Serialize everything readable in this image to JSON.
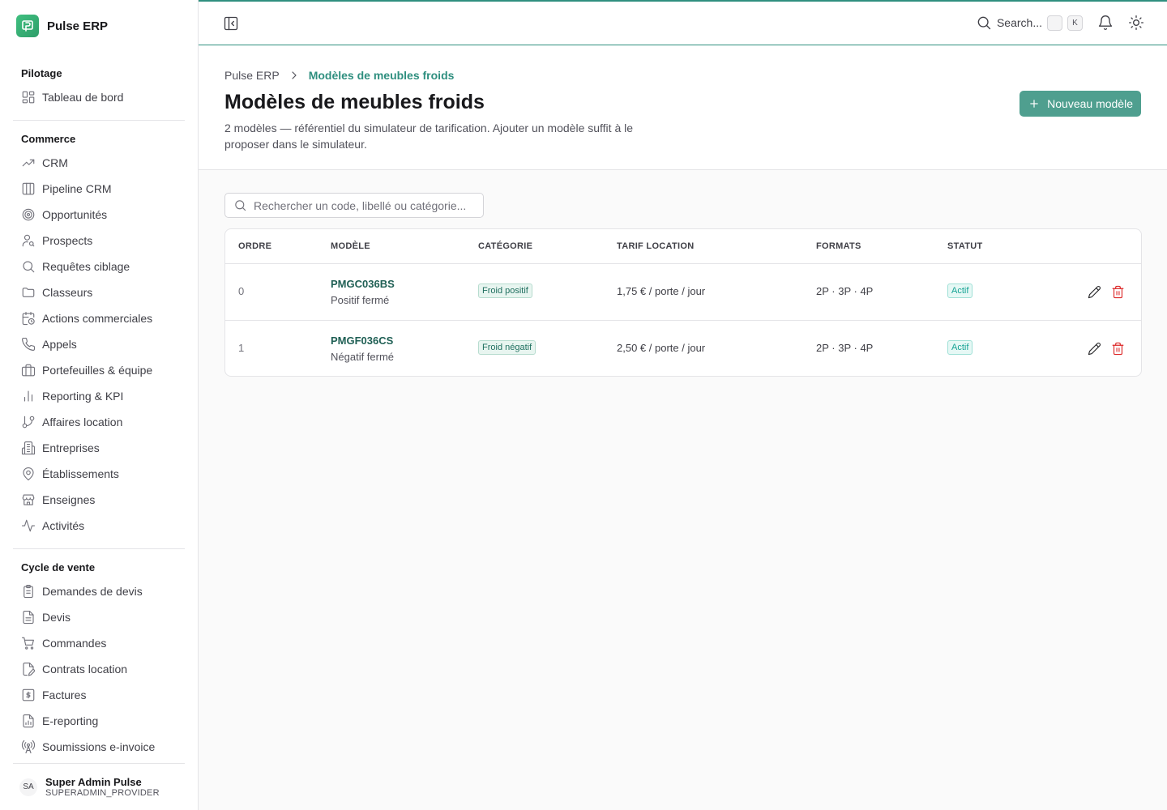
{
  "app": {
    "name": "Pulse ERP"
  },
  "sidebar": {
    "sections": [
      {
        "title": "Pilotage",
        "items": [
          {
            "label": "Tableau de bord",
            "icon": "dashboard-icon"
          }
        ]
      },
      {
        "title": "Commerce",
        "items": [
          {
            "label": "CRM",
            "icon": "trending-up-icon"
          },
          {
            "label": "Pipeline CRM",
            "icon": "kanban-icon"
          },
          {
            "label": "Opportunités",
            "icon": "target-icon"
          },
          {
            "label": "Prospects",
            "icon": "user-search-icon"
          },
          {
            "label": "Requêtes ciblage",
            "icon": "search-icon"
          },
          {
            "label": "Classeurs",
            "icon": "folder-icon"
          },
          {
            "label": "Actions commerciales",
            "icon": "calendar-clock-icon"
          },
          {
            "label": "Appels",
            "icon": "phone-icon"
          },
          {
            "label": "Portefeuilles & équipe",
            "icon": "briefcase-icon"
          },
          {
            "label": "Reporting & KPI",
            "icon": "bar-chart-icon"
          },
          {
            "label": "Affaires location",
            "icon": "git-branch-icon"
          },
          {
            "label": "Entreprises",
            "icon": "building-icon"
          },
          {
            "label": "Établissements",
            "icon": "map-pin-icon"
          },
          {
            "label": "Enseignes",
            "icon": "store-icon"
          },
          {
            "label": "Activités",
            "icon": "activity-icon"
          }
        ]
      },
      {
        "title": "Cycle de vente",
        "items": [
          {
            "label": "Demandes de devis",
            "icon": "clipboard-list-icon"
          },
          {
            "label": "Devis",
            "icon": "file-text-icon"
          },
          {
            "label": "Commandes",
            "icon": "cart-icon"
          },
          {
            "label": "Contrats location",
            "icon": "file-signature-icon"
          },
          {
            "label": "Factures",
            "icon": "dollar-receipt-icon"
          },
          {
            "label": "E-reporting",
            "icon": "file-chart-icon"
          },
          {
            "label": "Soumissions e-invoice",
            "icon": "radio-tower-icon"
          }
        ]
      }
    ]
  },
  "user": {
    "initials": "SA",
    "name": "Super Admin Pulse",
    "role": "SUPERADMIN_PROVIDER"
  },
  "topbar": {
    "search_label": "Search...",
    "kbd_1": "",
    "kbd_2": "K"
  },
  "breadcrumb": {
    "root": "Pulse ERP",
    "current": "Modèles de meubles froids"
  },
  "page": {
    "title": "Modèles de meubles froids",
    "subtitle": "2 modèles — référentiel du simulateur de tarification. Ajouter un modèle suffit à le proposer dans le simulateur.",
    "new_button": "Nouveau modèle"
  },
  "search": {
    "placeholder": "Rechercher un code, libellé ou catégorie..."
  },
  "table": {
    "headers": [
      "ORDRE",
      "MODÈLE",
      "CATÉGORIE",
      "TARIF LOCATION",
      "FORMATS",
      "STATUT"
    ],
    "rows": [
      {
        "order": "0",
        "code": "PMGC036BS",
        "label": "Positif fermé",
        "category": "Froid positif",
        "tarif": "1,75 € / porte / jour",
        "formats": "2P · 3P · 4P",
        "status": "Actif"
      },
      {
        "order": "1",
        "code": "PMGF036CS",
        "label": "Négatif fermé",
        "category": "Froid négatif",
        "tarif": "2,50 € / porte / jour",
        "formats": "2P · 3P · 4P",
        "status": "Actif"
      }
    ]
  },
  "colors": {
    "accent": "#2f8f7f",
    "button": "#4f9f8f",
    "danger": "#dc2626"
  }
}
